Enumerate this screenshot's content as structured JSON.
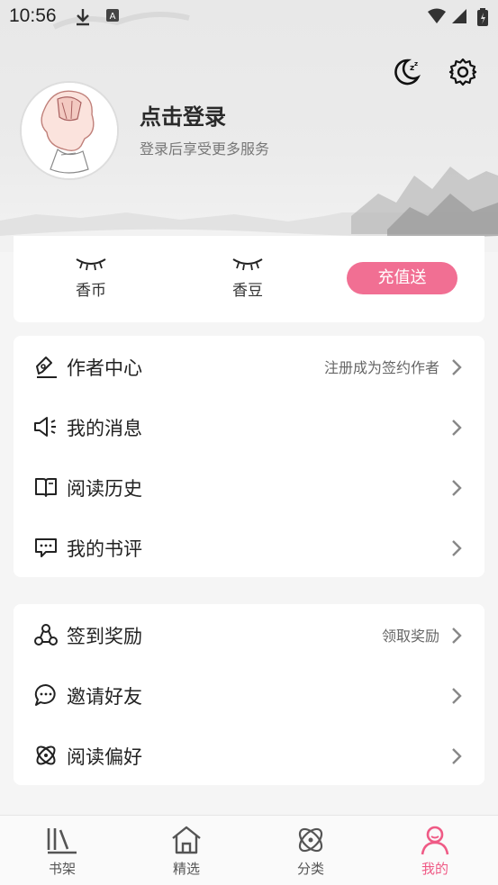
{
  "status_bar": {
    "time": "10:56"
  },
  "header": {
    "login_title": "点击登录",
    "login_subtitle": "登录后享受更多服务"
  },
  "wallet": {
    "items": [
      {
        "label": "香币"
      },
      {
        "label": "香豆"
      }
    ],
    "recharge_label": "充值送"
  },
  "menu_group_1": [
    {
      "label": "作者中心",
      "hint": "注册成为签约作者",
      "icon": "pen-icon"
    },
    {
      "label": "我的消息",
      "hint": "",
      "icon": "speaker-icon"
    },
    {
      "label": "阅读历史",
      "hint": "",
      "icon": "book-icon"
    },
    {
      "label": "我的书评",
      "hint": "",
      "icon": "comment-icon"
    }
  ],
  "menu_group_2": [
    {
      "label": "签到奖励",
      "hint": "领取奖励",
      "icon": "checkin-icon"
    },
    {
      "label": "邀请好友",
      "hint": "",
      "icon": "chat-icon"
    },
    {
      "label": "阅读偏好",
      "hint": "",
      "icon": "preference-icon"
    }
  ],
  "tabs": [
    {
      "label": "书架",
      "icon": "bookshelf-icon",
      "active": false
    },
    {
      "label": "精选",
      "icon": "home-icon",
      "active": false
    },
    {
      "label": "分类",
      "icon": "category-icon",
      "active": false
    },
    {
      "label": "我的",
      "icon": "profile-icon",
      "active": true
    }
  ],
  "colors": {
    "accent": "#f16f93",
    "active_tab": "#ef5a85"
  }
}
